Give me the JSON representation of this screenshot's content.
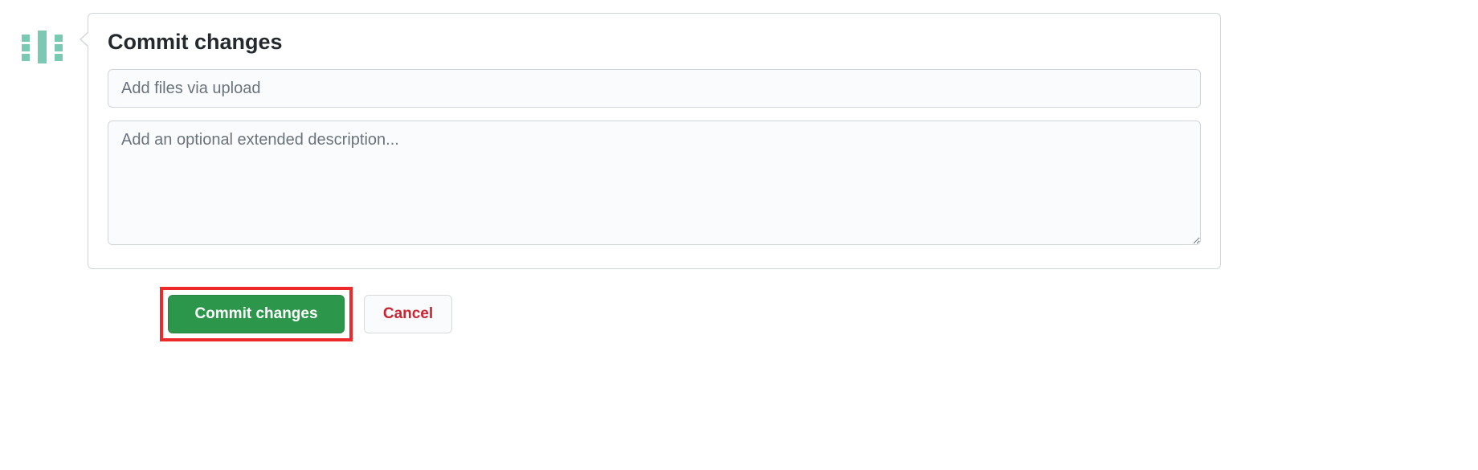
{
  "commit": {
    "heading": "Commit changes",
    "summary_placeholder": "Add files via upload",
    "summary_value": "",
    "description_placeholder": "Add an optional extended description...",
    "description_value": ""
  },
  "buttons": {
    "commit_label": "Commit changes",
    "cancel_label": "Cancel"
  },
  "colors": {
    "primary_button_bg": "#2c974b",
    "danger_text": "#cb2431",
    "highlight_border": "#ef2929",
    "avatar_tint": "#7ac9b3"
  }
}
